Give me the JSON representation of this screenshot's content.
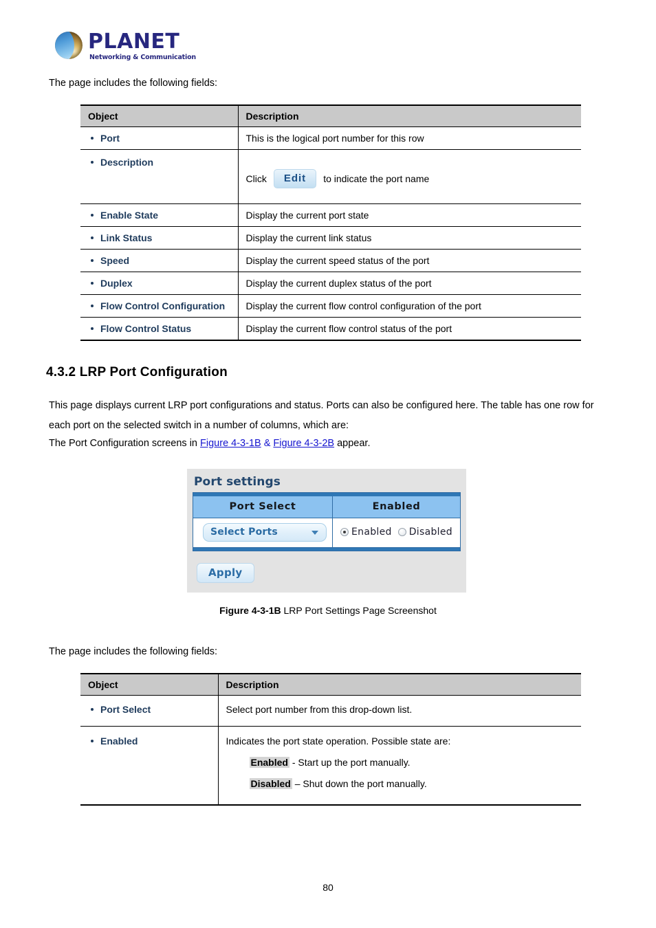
{
  "logo": {
    "wordmark": "PLANET",
    "tagline": "Networking & Communication"
  },
  "lead_text_1": "The page includes the following fields:",
  "lead_text_2": "The page includes the following fields:",
  "table1": {
    "headers": [
      "Object",
      "Description"
    ],
    "rows": [
      {
        "object": "Port",
        "description": "This is the logical port number for this row"
      },
      {
        "object": "Description",
        "description_prefix": "Click",
        "button_label": "Edit",
        "description_suffix": "to indicate the port name"
      },
      {
        "object": "Enable State",
        "description": "Display the current port state"
      },
      {
        "object": "Link Status",
        "description": "Display the current link status"
      },
      {
        "object": "Speed",
        "description": "Display the current speed status of the port"
      },
      {
        "object": "Duplex",
        "description": "Display the current duplex status of the port"
      },
      {
        "object": "Flow Control Configuration",
        "description": "Display the current flow control configuration of the port"
      },
      {
        "object": "Flow Control Status",
        "description": "Display the current flow control status of the port"
      }
    ]
  },
  "section": {
    "heading": "4.3.2 LRP Port Configuration",
    "paragraph": "This page displays current LRP port configurations and status. Ports can also be configured here. The table has one row for each port on the selected switch in a number of columns, which are:",
    "screens_prefix": "The Port Configuration screens in ",
    "link_1": "Figure 4-3-1B",
    "link_joiner": " & ",
    "link_2": "Figure 4-3-2B",
    "screens_suffix": " appear."
  },
  "screenshot": {
    "title": "Port settings",
    "columns": [
      "Port Select",
      "Enabled"
    ],
    "port_select_value": "Select Ports",
    "radios": [
      {
        "label": "Enabled",
        "selected": true
      },
      {
        "label": "Disabled",
        "selected": false
      }
    ],
    "apply_label": "Apply"
  },
  "figure_caption": {
    "label": "Figure 4-3-1B",
    "text": " LRP Port Settings Page Screenshot"
  },
  "table2": {
    "headers": [
      "Object",
      "Description"
    ],
    "rows": [
      {
        "object": "Port Select",
        "description": "Select port number from this drop-down list."
      },
      {
        "object": "Enabled",
        "description": "Indicates the port state operation. Possible state are:",
        "state_enabled_label": "Enabled",
        "state_enabled_text": " - Start up the port manually.",
        "state_disabled_label": "Disabled",
        "state_disabled_text": " – Shut down the port manually."
      }
    ]
  },
  "page_number": "80"
}
